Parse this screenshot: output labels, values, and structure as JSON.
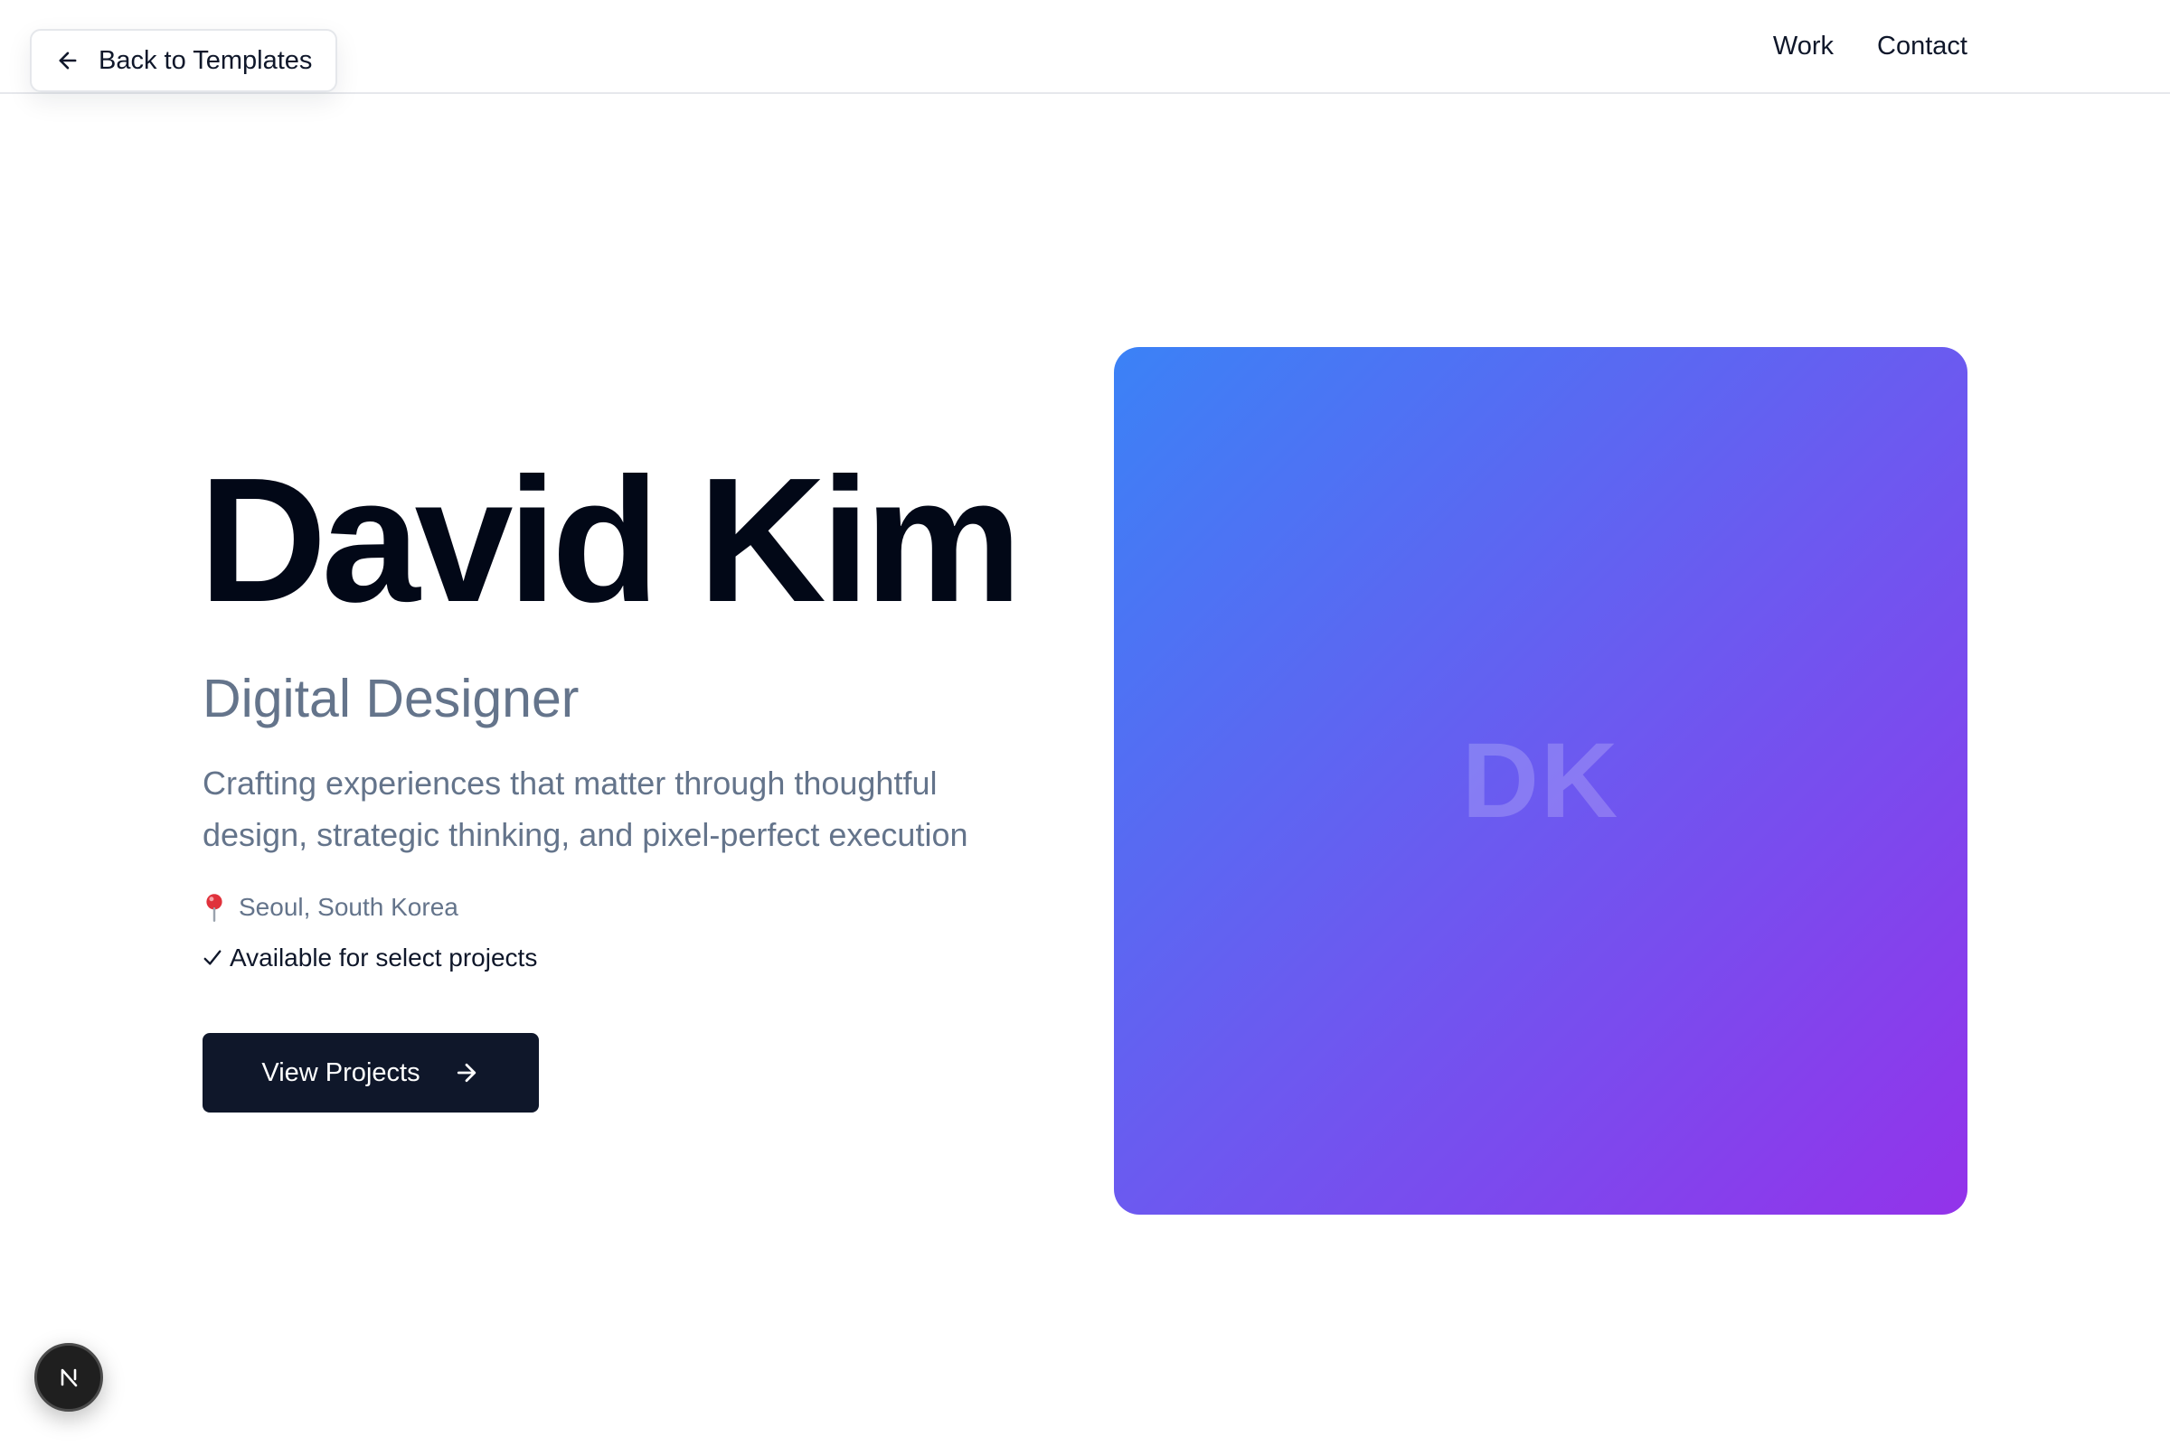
{
  "header": {
    "back_label": "Back to Templates",
    "nav": [
      {
        "label": "Work"
      },
      {
        "label": "Contact"
      }
    ]
  },
  "hero": {
    "name": "David Kim",
    "role": "Digital Designer",
    "tagline": "Crafting experiences that matter through thoughtful design, strategic thinking, and pixel-perfect execution",
    "location": "Seoul, South Korea",
    "availability": "Available for select projects",
    "cta_label": "View Projects",
    "initials": "DK"
  },
  "icons": {
    "back": "arrow-left-icon",
    "location": "map-pin-icon",
    "availability": "check-icon",
    "cta": "arrow-right-icon",
    "badge": "n-logo-icon"
  },
  "colors": {
    "primary_dark": "#0f172a",
    "muted_text": "#64748b",
    "gradient_start": "#3b82f6",
    "gradient_end": "#9333ea"
  }
}
